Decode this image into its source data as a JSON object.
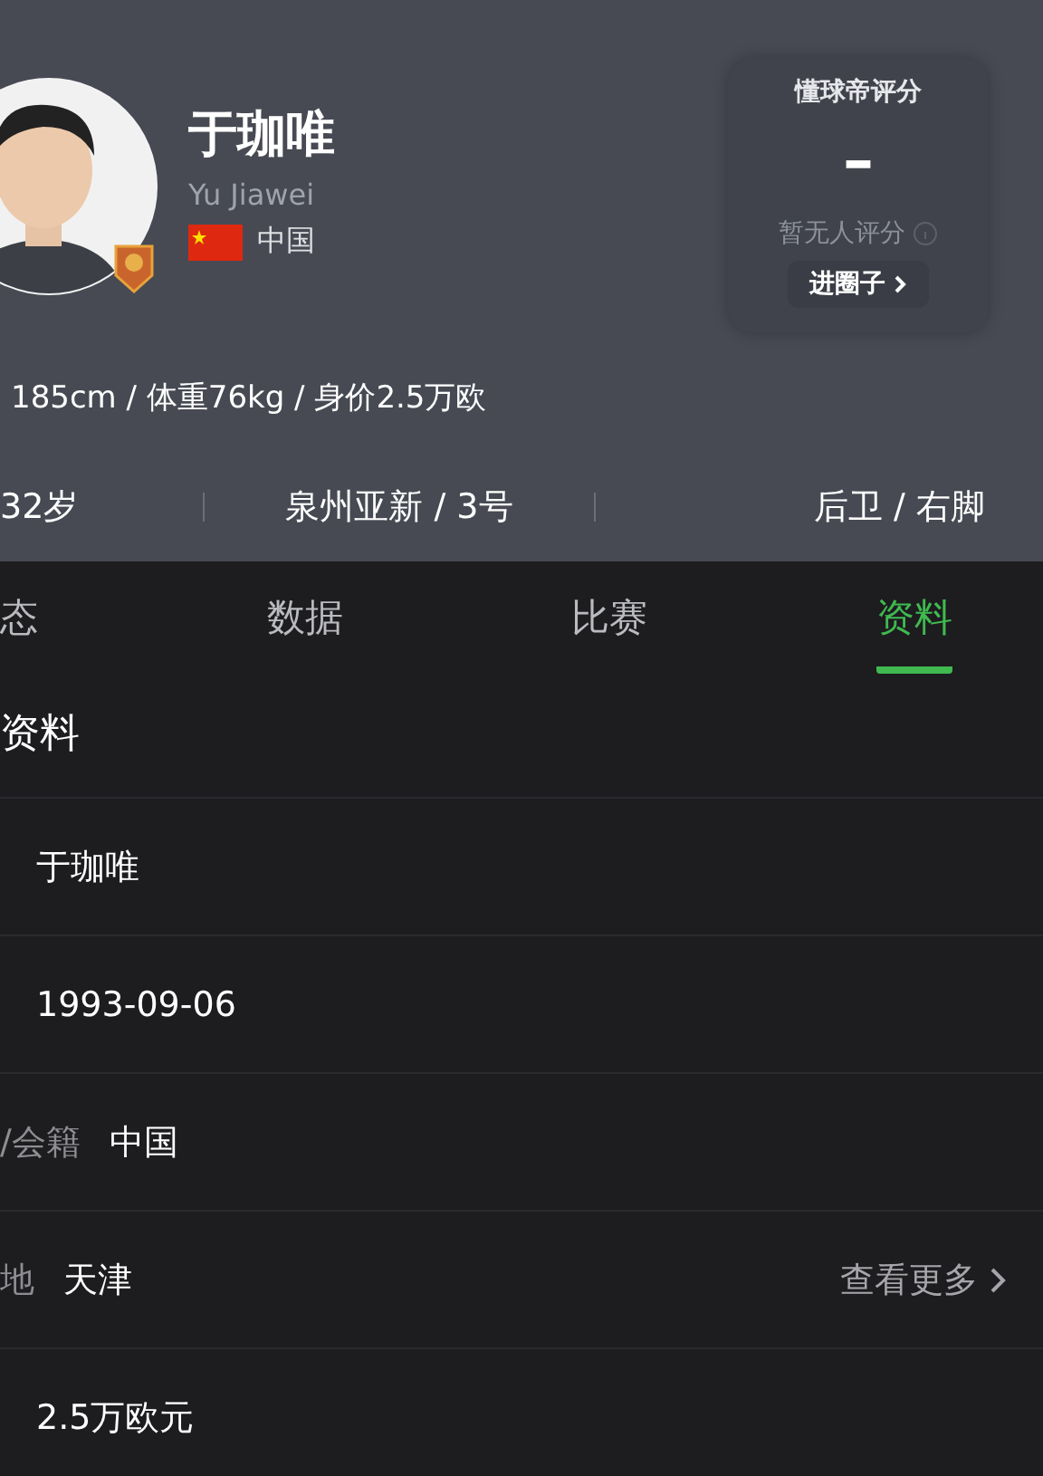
{
  "player": {
    "name": "于珈唯",
    "name_en": "Yu Jiawei",
    "country": "中国",
    "body": "185cm / 体重76kg / 身价2.5万欧"
  },
  "rating": {
    "title": "懂球帝评分",
    "score": "–",
    "note": "暂无人评分",
    "link": "进圈子"
  },
  "facts": [
    "32岁",
    "泉州亚新 / 3号",
    "后卫 / 右脚"
  ],
  "tabs": [
    {
      "label": "态",
      "selected": false
    },
    {
      "label": "数据",
      "selected": false
    },
    {
      "label": "比赛",
      "selected": false
    },
    {
      "label": "资料",
      "selected": true
    }
  ],
  "section_title": "资料",
  "rows": [
    {
      "value": "于珈唯"
    },
    {
      "value": "1993-09-06"
    },
    {
      "label": "/会籍",
      "value": "中国"
    },
    {
      "label": "地",
      "value": "天津",
      "more": "查看更多"
    },
    {
      "value": "2.5万欧元"
    }
  ]
}
